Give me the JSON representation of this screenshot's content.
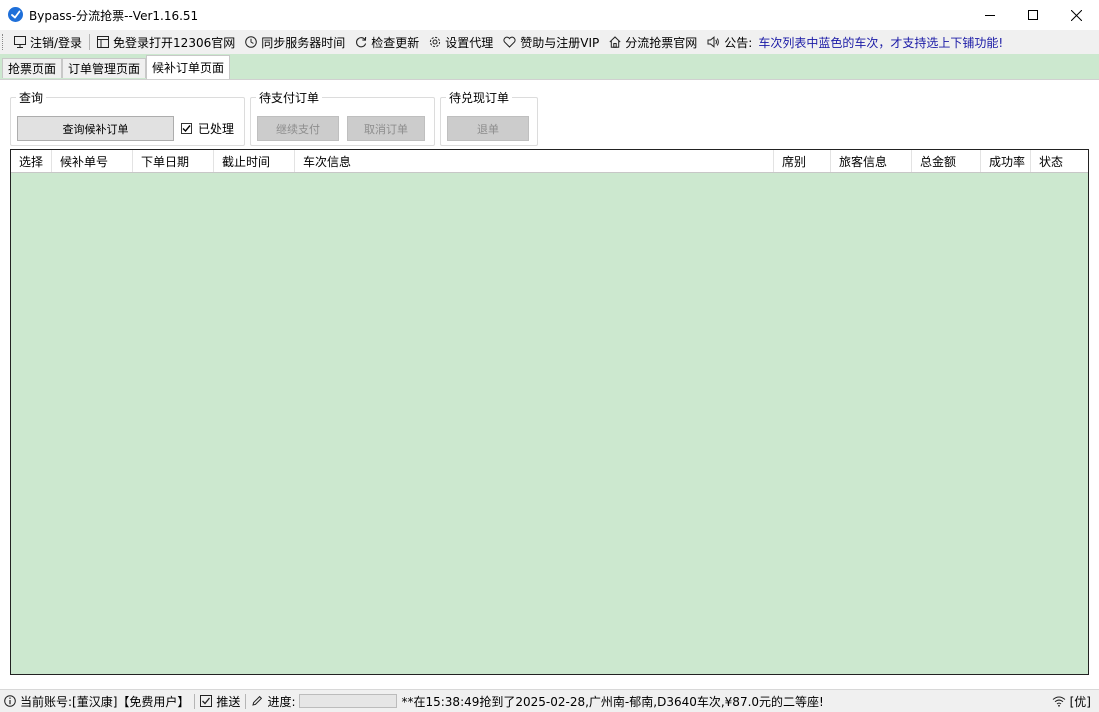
{
  "window": {
    "title": "Bypass-分流抢票--Ver1.16.51",
    "accent": "#1e6fd9"
  },
  "toolbar": {
    "logout_login": "注销/登录",
    "open_12306": "免登录打开12306官网",
    "sync_time": "同步服务器时间",
    "check_update": "检查更新",
    "set_proxy": "设置代理",
    "sponsor_vip": "赞助与注册VIP",
    "official_site": "分流抢票官网",
    "notice_label": "公告:",
    "notice_text": "车次列表中蓝色的车次，才支持选上下铺功能!"
  },
  "tabs": [
    {
      "label": "抢票页面",
      "active": false
    },
    {
      "label": "订单管理页面",
      "active": false
    },
    {
      "label": "候补订单页面",
      "active": true
    }
  ],
  "query_group": {
    "legend": "查询",
    "query_button": "查询候补订单",
    "processed_label": "已处理",
    "processed_checked": true
  },
  "pending_pay_group": {
    "legend": "待支付订单",
    "continue_pay": "继续支付",
    "cancel_order": "取消订单"
  },
  "pending_redeem_group": {
    "legend": "待兑现订单",
    "refund": "退单"
  },
  "table": {
    "columns": [
      "选择",
      "候补单号",
      "下单日期",
      "截止时间",
      "车次信息",
      "席别",
      "旅客信息",
      "总金额",
      "成功率",
      "状态"
    ],
    "rows": [],
    "background": "#cce8cf"
  },
  "statusbar": {
    "account": "当前账号:[董汉康]【免费用户】",
    "push_label": "推送",
    "push_checked": true,
    "progress_label": "进度:",
    "progress_value": 0,
    "message": "**在15:38:49抢到了2025-02-28,广州南-郁南,D3640车次,¥87.0元的二等座!",
    "right_label": "[优]"
  }
}
